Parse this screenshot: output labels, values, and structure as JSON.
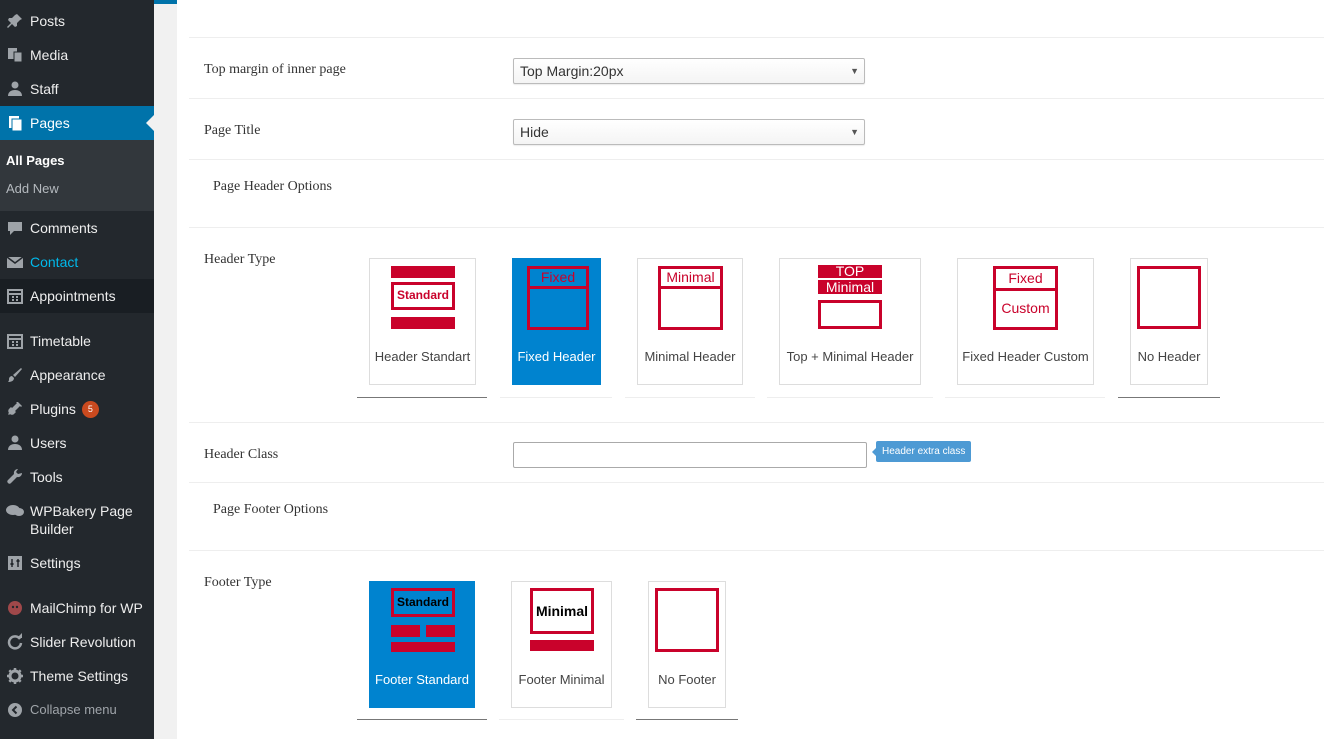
{
  "sidebar": {
    "items": [
      {
        "label": "Posts",
        "icon": "pin-icon"
      },
      {
        "label": "Media",
        "icon": "media-icon"
      },
      {
        "label": "Staff",
        "icon": "user-icon"
      },
      {
        "label": "Pages",
        "icon": "pages-icon"
      },
      {
        "label": "Comments",
        "icon": "comment-icon"
      },
      {
        "label": "Contact",
        "icon": "mail-icon"
      },
      {
        "label": "Appointments",
        "icon": "calendar-icon"
      },
      {
        "label": "Timetable",
        "icon": "calendar-icon"
      },
      {
        "label": "Appearance",
        "icon": "brush-icon"
      },
      {
        "label": "Plugins",
        "icon": "plug-icon",
        "badge": "5"
      },
      {
        "label": "Users",
        "icon": "user-icon"
      },
      {
        "label": "Tools",
        "icon": "wrench-icon"
      },
      {
        "label": "WPBakery Page Builder",
        "label_line1": "WPBakery Page",
        "label_line2": "Builder",
        "icon": "bubble-icon"
      },
      {
        "label": "Settings",
        "icon": "settings-icon"
      },
      {
        "label": "MailChimp for WP",
        "icon": "mailchimp-icon"
      },
      {
        "label": "Slider Revolution",
        "icon": "refresh-icon"
      },
      {
        "label": "Theme Settings",
        "icon": "gear-icon"
      }
    ],
    "submenu": [
      {
        "label": "All Pages"
      },
      {
        "label": "Add New"
      }
    ],
    "collapse_label": "Collapse menu"
  },
  "form": {
    "top_margin": {
      "label": "Top margin of inner page",
      "value": "Top Margin:20px"
    },
    "page_title": {
      "label": "Page Title",
      "value": "Hide"
    },
    "header_section": "Page Header Options",
    "header_type": {
      "label": "Header Type",
      "options": [
        {
          "caption": "Header Standart",
          "selected": false,
          "art": "Standard"
        },
        {
          "caption": "Fixed Header",
          "selected": true,
          "art": "Fixed"
        },
        {
          "caption": "Minimal Header",
          "selected": false,
          "art": "Minimal"
        },
        {
          "caption": "Top + Minimal Header",
          "selected": false,
          "art_top": "TOP",
          "art_bottom": "Minimal"
        },
        {
          "caption": "Fixed Header Custom",
          "selected": false,
          "art_top": "Fixed",
          "art_bottom": "Custom"
        },
        {
          "caption": "No Header",
          "selected": false
        }
      ]
    },
    "header_class": {
      "label": "Header Class",
      "value": "",
      "tooltip": "Header extra class"
    },
    "footer_section": "Page Footer Options",
    "footer_type": {
      "label": "Footer Type",
      "options": [
        {
          "caption": "Footer Standart",
          "caption_display": "Footer Standard",
          "selected": true,
          "art": "Standard"
        },
        {
          "caption": "Footer Minimal",
          "selected": false,
          "art": "Minimal"
        },
        {
          "caption": "No Footer",
          "selected": false
        }
      ]
    }
  },
  "colors": {
    "accent": "#0073aa",
    "selected_card": "#0083cf",
    "art_red": "#c9022b",
    "sidebar_bg": "#23282d"
  }
}
